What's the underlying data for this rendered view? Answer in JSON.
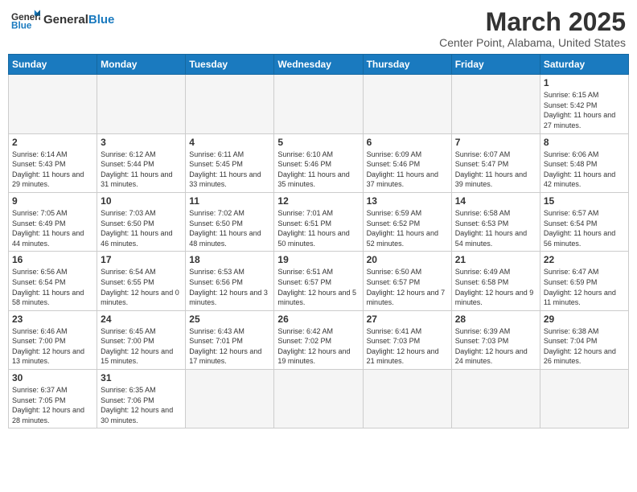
{
  "header": {
    "logo_general": "General",
    "logo_blue": "Blue",
    "month_title": "March 2025",
    "subtitle": "Center Point, Alabama, United States"
  },
  "weekdays": [
    "Sunday",
    "Monday",
    "Tuesday",
    "Wednesday",
    "Thursday",
    "Friday",
    "Saturday"
  ],
  "weeks": [
    [
      {
        "day": "",
        "empty": true
      },
      {
        "day": "",
        "empty": true
      },
      {
        "day": "",
        "empty": true
      },
      {
        "day": "",
        "empty": true
      },
      {
        "day": "",
        "empty": true
      },
      {
        "day": "",
        "empty": true
      },
      {
        "day": "1",
        "sunrise": "6:15 AM",
        "sunset": "5:42 PM",
        "daylight": "11 hours and 27 minutes."
      }
    ],
    [
      {
        "day": "2",
        "sunrise": "6:14 AM",
        "sunset": "5:43 PM",
        "daylight": "11 hours and 29 minutes."
      },
      {
        "day": "3",
        "sunrise": "6:12 AM",
        "sunset": "5:44 PM",
        "daylight": "11 hours and 31 minutes."
      },
      {
        "day": "4",
        "sunrise": "6:11 AM",
        "sunset": "5:45 PM",
        "daylight": "11 hours and 33 minutes."
      },
      {
        "day": "5",
        "sunrise": "6:10 AM",
        "sunset": "5:46 PM",
        "daylight": "11 hours and 35 minutes."
      },
      {
        "day": "6",
        "sunrise": "6:09 AM",
        "sunset": "5:46 PM",
        "daylight": "11 hours and 37 minutes."
      },
      {
        "day": "7",
        "sunrise": "6:07 AM",
        "sunset": "5:47 PM",
        "daylight": "11 hours and 39 minutes."
      },
      {
        "day": "8",
        "sunrise": "6:06 AM",
        "sunset": "5:48 PM",
        "daylight": "11 hours and 42 minutes."
      }
    ],
    [
      {
        "day": "9",
        "sunrise": "7:05 AM",
        "sunset": "6:49 PM",
        "daylight": "11 hours and 44 minutes."
      },
      {
        "day": "10",
        "sunrise": "7:03 AM",
        "sunset": "6:50 PM",
        "daylight": "11 hours and 46 minutes."
      },
      {
        "day": "11",
        "sunrise": "7:02 AM",
        "sunset": "6:50 PM",
        "daylight": "11 hours and 48 minutes."
      },
      {
        "day": "12",
        "sunrise": "7:01 AM",
        "sunset": "6:51 PM",
        "daylight": "11 hours and 50 minutes."
      },
      {
        "day": "13",
        "sunrise": "6:59 AM",
        "sunset": "6:52 PM",
        "daylight": "11 hours and 52 minutes."
      },
      {
        "day": "14",
        "sunrise": "6:58 AM",
        "sunset": "6:53 PM",
        "daylight": "11 hours and 54 minutes."
      },
      {
        "day": "15",
        "sunrise": "6:57 AM",
        "sunset": "6:54 PM",
        "daylight": "11 hours and 56 minutes."
      }
    ],
    [
      {
        "day": "16",
        "sunrise": "6:56 AM",
        "sunset": "6:54 PM",
        "daylight": "11 hours and 58 minutes."
      },
      {
        "day": "17",
        "sunrise": "6:54 AM",
        "sunset": "6:55 PM",
        "daylight": "12 hours and 0 minutes."
      },
      {
        "day": "18",
        "sunrise": "6:53 AM",
        "sunset": "6:56 PM",
        "daylight": "12 hours and 3 minutes."
      },
      {
        "day": "19",
        "sunrise": "6:51 AM",
        "sunset": "6:57 PM",
        "daylight": "12 hours and 5 minutes."
      },
      {
        "day": "20",
        "sunrise": "6:50 AM",
        "sunset": "6:57 PM",
        "daylight": "12 hours and 7 minutes."
      },
      {
        "day": "21",
        "sunrise": "6:49 AM",
        "sunset": "6:58 PM",
        "daylight": "12 hours and 9 minutes."
      },
      {
        "day": "22",
        "sunrise": "6:47 AM",
        "sunset": "6:59 PM",
        "daylight": "12 hours and 11 minutes."
      }
    ],
    [
      {
        "day": "23",
        "sunrise": "6:46 AM",
        "sunset": "7:00 PM",
        "daylight": "12 hours and 13 minutes."
      },
      {
        "day": "24",
        "sunrise": "6:45 AM",
        "sunset": "7:00 PM",
        "daylight": "12 hours and 15 minutes."
      },
      {
        "day": "25",
        "sunrise": "6:43 AM",
        "sunset": "7:01 PM",
        "daylight": "12 hours and 17 minutes."
      },
      {
        "day": "26",
        "sunrise": "6:42 AM",
        "sunset": "7:02 PM",
        "daylight": "12 hours and 19 minutes."
      },
      {
        "day": "27",
        "sunrise": "6:41 AM",
        "sunset": "7:03 PM",
        "daylight": "12 hours and 21 minutes."
      },
      {
        "day": "28",
        "sunrise": "6:39 AM",
        "sunset": "7:03 PM",
        "daylight": "12 hours and 24 minutes."
      },
      {
        "day": "29",
        "sunrise": "6:38 AM",
        "sunset": "7:04 PM",
        "daylight": "12 hours and 26 minutes."
      }
    ],
    [
      {
        "day": "30",
        "sunrise": "6:37 AM",
        "sunset": "7:05 PM",
        "daylight": "12 hours and 28 minutes."
      },
      {
        "day": "31",
        "sunrise": "6:35 AM",
        "sunset": "7:06 PM",
        "daylight": "12 hours and 30 minutes."
      },
      {
        "day": "",
        "empty": true
      },
      {
        "day": "",
        "empty": true
      },
      {
        "day": "",
        "empty": true
      },
      {
        "day": "",
        "empty": true
      },
      {
        "day": "",
        "empty": true
      }
    ]
  ]
}
